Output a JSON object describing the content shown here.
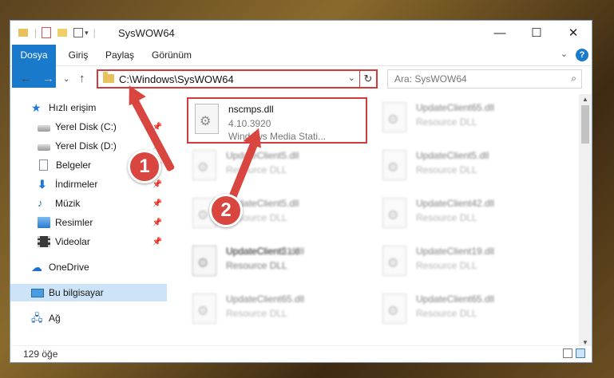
{
  "window": {
    "title": "SysWOW64"
  },
  "ribbon": {
    "tabs": [
      "Dosya",
      "Giriş",
      "Paylaş",
      "Görünüm"
    ]
  },
  "nav": {
    "address": "C:\\Windows\\SysWOW64",
    "search_placeholder": "Ara: SysWOW64"
  },
  "sidebar": {
    "items": [
      {
        "label": "Hızlı erişim",
        "icon": "star-icon"
      },
      {
        "label": "Yerel Disk (C:)",
        "icon": "drive-icon"
      },
      {
        "label": "Yerel Disk (D:)",
        "icon": "drive-icon"
      },
      {
        "label": "Belgeler",
        "icon": "documents-icon"
      },
      {
        "label": "İndirmeler",
        "icon": "download-icon"
      },
      {
        "label": "Müzik",
        "icon": "music-icon"
      },
      {
        "label": "Resimler",
        "icon": "pictures-icon"
      },
      {
        "label": "Videolar",
        "icon": "videos-icon"
      },
      {
        "label": "OneDrive",
        "icon": "cloud-icon"
      },
      {
        "label": "Bu bilgisayar",
        "icon": "computer-icon"
      },
      {
        "label": "Ağ",
        "icon": "network-icon"
      }
    ]
  },
  "files": {
    "highlighted": {
      "name": "nscmps.dll",
      "version": "4.10.3920",
      "description": "Windows Media Stati..."
    },
    "blurred": [
      {
        "name": "UpdateClient65.dll",
        "desc": "Resource DLL"
      },
      {
        "name": "UpdateClient5.dll",
        "desc": "Resource DLL"
      },
      {
        "name": "UpdateClient5.dll",
        "desc": "Resource DLL"
      },
      {
        "name": "UpdateClient5.dll",
        "desc": "Resource DLL"
      },
      {
        "name": "UpdateClient42.dll",
        "desc": "Resource DLL"
      },
      {
        "name": "UpdateClient5.dll",
        "desc": "Resource DLL"
      },
      {
        "name": "UpdateClient21.dll",
        "desc": "Resource DLL"
      },
      {
        "name": "UpdateClient19.dll",
        "desc": "Resource DLL"
      },
      {
        "name": "UpdateClient65.dll",
        "desc": "Resource DLL"
      },
      {
        "name": "UpdateClient65.dll",
        "desc": "Resource DLL"
      }
    ]
  },
  "status": {
    "item_count": "129 öğe"
  },
  "callouts": {
    "one": "1",
    "two": "2"
  },
  "colors": {
    "accent": "#1979ca",
    "highlight": "#d23b3b",
    "callout": "#d8463f"
  }
}
